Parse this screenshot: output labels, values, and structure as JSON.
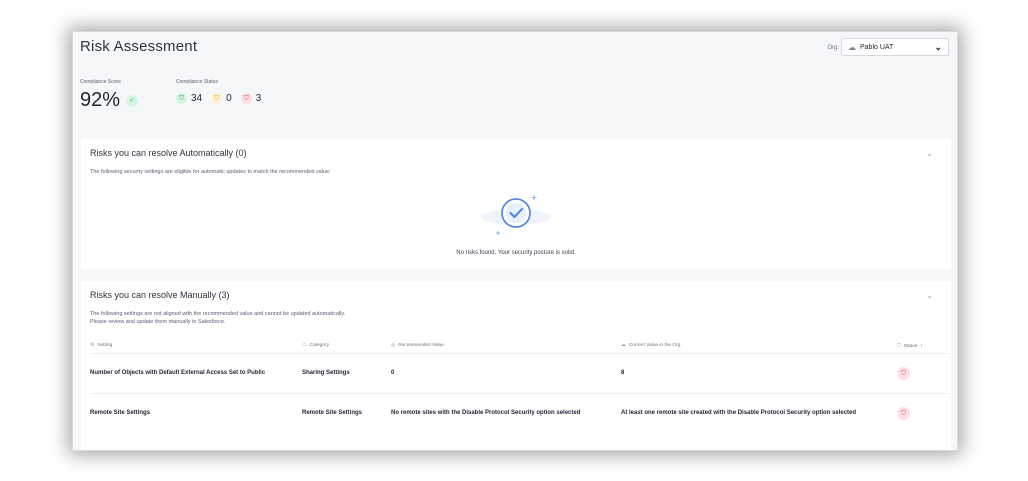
{
  "header": {
    "title": "Risk Assessment",
    "org_label": "Org:",
    "org_value": "Pablo UAT"
  },
  "scores": {
    "compliance_score_label": "Compliance Score",
    "compliance_score": "92%",
    "compliance_status_label": "Compliance Status",
    "status_counts": {
      "passed": "34",
      "warning": "0",
      "failed": "3"
    }
  },
  "auto_panel": {
    "title": "Risks you can resolve Automatically (0)",
    "description": "The following security settings are eligible for automatic updates to match the recommended value:",
    "empty_message": "No risks found. Your security posture is solid."
  },
  "manual_panel": {
    "title": "Risks you can resolve Manually (3)",
    "description_line1": "The following settings are not aligned with the recommended value and cannot be updated automatically.",
    "description_line2": "Please review and update them manually in Salesforce.",
    "columns": {
      "setting": "Setting",
      "category": "Category",
      "recommended": "Recommended Value",
      "current": "Current Value in the Org",
      "status": "Status"
    },
    "rows": [
      {
        "setting": "Number of Objects with Default External Access Set to Public",
        "category": "Sharing Settings",
        "recommended": "0",
        "current": "8"
      },
      {
        "setting": "Remote Site Settings",
        "category": "Remote Site Settings",
        "recommended": "No remote sites with the Disable Protocol Security option selected",
        "current": "At least one remote site created with the Disable Protocol Security option selected"
      }
    ]
  },
  "colors": {
    "success": "#35b36b",
    "warning": "#e0a32a",
    "danger": "#e04b5d",
    "accent": "#4a7fe0"
  },
  "icons": {
    "org": "cloud-icon",
    "dropdown": "chevron-down-icon",
    "check": "check-icon",
    "shield": "shield-icon",
    "sort": "sort-asc-icon"
  }
}
